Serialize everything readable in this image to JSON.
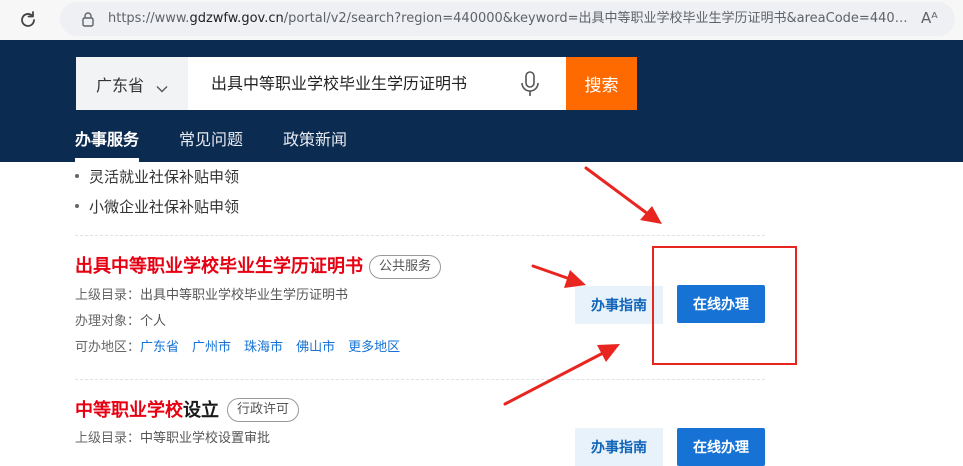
{
  "browser": {
    "url_prefix": "https://www.",
    "url_host": "gdzwfw.gov.cn",
    "url_path": "/portal/v2/search?region=440000&keyword=出具中等职业学校毕业生学历证明书&areaCode=44000...",
    "reader_label": "Aᴬ"
  },
  "search": {
    "region": "广东省",
    "query": "出具中等职业学校毕业生学历证明书",
    "button": "搜索"
  },
  "tabs": [
    "办事服务",
    "常见问题",
    "政策新闻"
  ],
  "bullets": [
    "灵活就业社保补贴申领",
    "小微企业社保补贴申领"
  ],
  "results": [
    {
      "title_red": "出具中等职业学校毕业生学历证明书",
      "title_dark": "",
      "badge": "公共服务",
      "parent_label": "上级目录：",
      "parent_value": "出具中等职业学校毕业生学历证明书",
      "target_label": "办理对象：",
      "target_value": "个人",
      "area_label": "可办地区：",
      "areas": [
        "广东省",
        "广州市",
        "珠海市",
        "佛山市",
        "更多地区"
      ],
      "guide_button": "办事指南",
      "online_button": "在线办理"
    },
    {
      "title_red": "中等职业学校",
      "title_dark": "设立",
      "badge": "行政许可",
      "parent_label": "上级目录：",
      "parent_value": "中等职业学校设置审批",
      "guide_button": "办事指南",
      "online_button": "在线办理"
    }
  ],
  "colors": {
    "header_bg": "#0c2b50",
    "search_button": "#ff6a00",
    "title_red": "#e60012",
    "link_blue": "#1672d4",
    "annotation_red": "#e8251f"
  }
}
